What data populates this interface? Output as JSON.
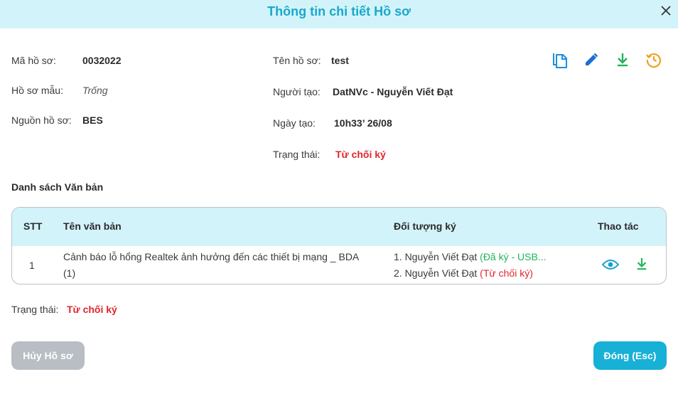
{
  "header": {
    "title": "Thông tin chi tiết Hồ sơ"
  },
  "info": {
    "ma_ho_so": {
      "label": "Mã hồ sơ:",
      "value": "0032022"
    },
    "ho_so_mau": {
      "label": "Hồ sơ mẫu:",
      "value": "Trống"
    },
    "nguon_ho_so": {
      "label": "Nguồn hồ sơ:",
      "value": "BES"
    },
    "ten_ho_so": {
      "label": "Tên hồ sơ:",
      "value": "test"
    },
    "nguoi_tao": {
      "label": "Người tạo:",
      "value": "DatNVc - Nguyễn Viết Đạt"
    },
    "ngay_tao": {
      "label": "Ngày tạo:",
      "value": "10h33’ 26/08"
    },
    "trang_thai": {
      "label": "Trạng thái:",
      "value": "Từ chối ký"
    }
  },
  "actions": [
    "copy-icon",
    "edit-icon",
    "download-icon",
    "history-icon"
  ],
  "colors": {
    "accent": "#18a9c9",
    "header_bg": "#d3f3fb",
    "red": "#e0262c",
    "green": "#20b45a",
    "history": "#f0a020"
  },
  "documents": {
    "title": "Danh sách Văn bản",
    "columns": {
      "stt": "STT",
      "name": "Tên văn bản",
      "signer": "Đối tượng ký",
      "action": "Thao tác"
    },
    "rows": [
      {
        "stt": "1",
        "name_line1": "Cảnh báo lỗ hổng Realtek ảnh hưởng đến các thiết bị mạng _ BDA",
        "name_line2": "(1)",
        "signers": [
          {
            "name": "1. Nguyễn Viết Đạt",
            "status": "(Đã ký - USB..."
          },
          {
            "name": "2. Nguyễn Viết Đạt",
            "status": "(Từ chối ký)"
          }
        ]
      }
    ]
  },
  "footer_status": {
    "label": "Trạng thái:",
    "value": "Từ chối ký"
  },
  "buttons": {
    "cancel": "Hủy Hồ sơ",
    "close": "Đóng (Esc)"
  }
}
